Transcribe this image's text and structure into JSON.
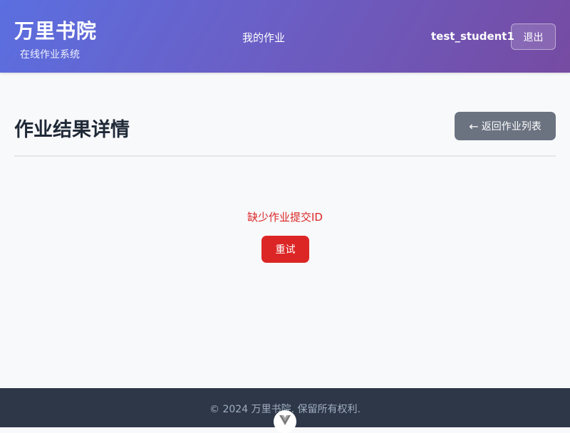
{
  "header": {
    "brand": "万里书院",
    "subtitle": "在线作业系统",
    "nav_my_homework": "我的作业",
    "username": "test_student1",
    "logout_label": "退出"
  },
  "main": {
    "title": "作业结果详情",
    "back_arrow": "←",
    "back_label": "返回作业列表",
    "error_message": "缺少作业提交ID",
    "retry_label": "重试"
  },
  "footer": {
    "copyright": "© 2024 万里书院. 保留所有权利.",
    "badge_icon": "vue-logo-icon"
  },
  "colors": {
    "header_gradient_start": "#5b6fe0",
    "header_gradient_end": "#764ba2",
    "error": "#dc2626",
    "back_button": "#6b7280",
    "footer_bg": "#2d3748"
  }
}
